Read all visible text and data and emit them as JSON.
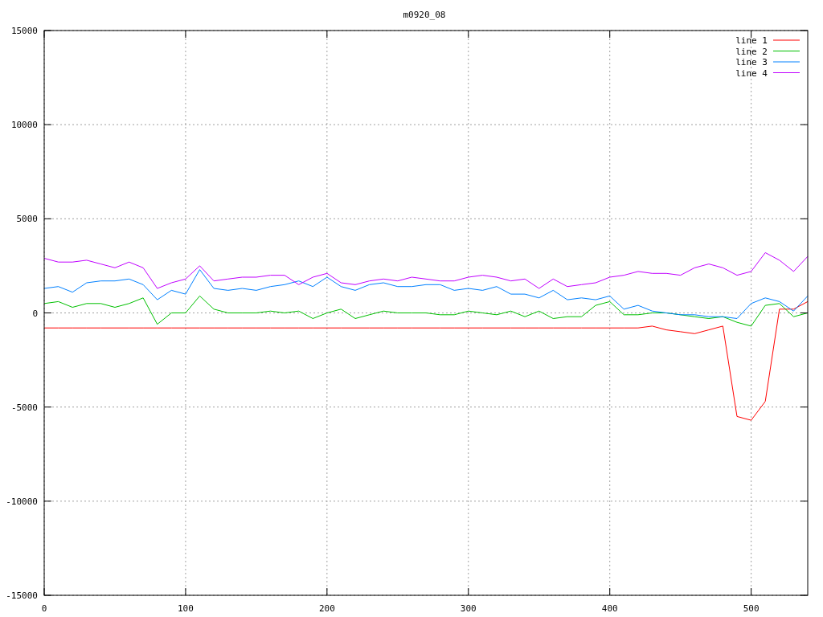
{
  "chart_data": {
    "type": "line",
    "title": "m0920_08",
    "grid": true,
    "legend": true,
    "xlim": [
      0,
      540
    ],
    "ylim": [
      -15000,
      15000
    ],
    "xticks": [
      0,
      100,
      200,
      300,
      400,
      500
    ],
    "yticks": [
      -15000,
      -10000,
      -5000,
      0,
      5000,
      10000,
      15000
    ],
    "x": [
      0,
      10,
      20,
      30,
      40,
      50,
      60,
      70,
      80,
      90,
      100,
      110,
      120,
      130,
      140,
      150,
      160,
      170,
      180,
      190,
      200,
      210,
      220,
      230,
      240,
      250,
      260,
      270,
      280,
      290,
      300,
      310,
      320,
      330,
      340,
      350,
      360,
      370,
      380,
      390,
      400,
      410,
      420,
      430,
      440,
      450,
      460,
      470,
      480,
      490,
      500,
      510,
      520,
      530,
      540
    ],
    "series": [
      {
        "name": "line 1",
        "color": "#ff0000",
        "values": [
          -800,
          -800,
          -800,
          -800,
          -800,
          -800,
          -800,
          -800,
          -800,
          -800,
          -800,
          -800,
          -800,
          -800,
          -800,
          -800,
          -800,
          -800,
          -800,
          -800,
          -800,
          -800,
          -800,
          -800,
          -800,
          -800,
          -800,
          -800,
          -800,
          -800,
          -800,
          -800,
          -800,
          -800,
          -800,
          -800,
          -800,
          -800,
          -800,
          -800,
          -800,
          -800,
          -800,
          -700,
          -900,
          -1000,
          -1100,
          -900,
          -700,
          -5500,
          -5700,
          -4700,
          200,
          200,
          600
        ]
      },
      {
        "name": "line 2",
        "color": "#00c000",
        "values": [
          500,
          600,
          300,
          500,
          500,
          300,
          500,
          800,
          -600,
          0,
          0,
          900,
          200,
          0,
          0,
          0,
          100,
          0,
          100,
          -300,
          0,
          200,
          -300,
          -100,
          100,
          0,
          0,
          0,
          -100,
          -100,
          100,
          0,
          -100,
          100,
          -200,
          100,
          -300,
          -200,
          -200,
          400,
          600,
          -100,
          -100,
          0,
          0,
          -100,
          -200,
          -300,
          -200,
          -500,
          -700,
          400,
          500,
          -200,
          0
        ]
      },
      {
        "name": "line 3",
        "color": "#0080ff",
        "values": [
          1300,
          1400,
          1100,
          1600,
          1700,
          1700,
          1800,
          1500,
          700,
          1200,
          1000,
          2300,
          1300,
          1200,
          1300,
          1200,
          1400,
          1500,
          1700,
          1400,
          1900,
          1400,
          1200,
          1500,
          1600,
          1400,
          1400,
          1500,
          1500,
          1200,
          1300,
          1200,
          1400,
          1000,
          1000,
          800,
          1200,
          700,
          800,
          700,
          900,
          200,
          400,
          100,
          0,
          -100,
          -100,
          -200,
          -200,
          -300,
          500,
          800,
          600,
          100,
          900
        ]
      },
      {
        "name": "line 4",
        "color": "#c000ff",
        "values": [
          2900,
          2700,
          2700,
          2800,
          2600,
          2400,
          2700,
          2400,
          1300,
          1600,
          1800,
          2500,
          1700,
          1800,
          1900,
          1900,
          2000,
          2000,
          1500,
          1900,
          2100,
          1600,
          1500,
          1700,
          1800,
          1700,
          1900,
          1800,
          1700,
          1700,
          1900,
          2000,
          1900,
          1700,
          1800,
          1300,
          1800,
          1400,
          1500,
          1600,
          1900,
          2000,
          2200,
          2100,
          2100,
          2000,
          2400,
          2600,
          2400,
          2000,
          2200,
          3200,
          2800,
          2200,
          3000
        ]
      }
    ]
  }
}
